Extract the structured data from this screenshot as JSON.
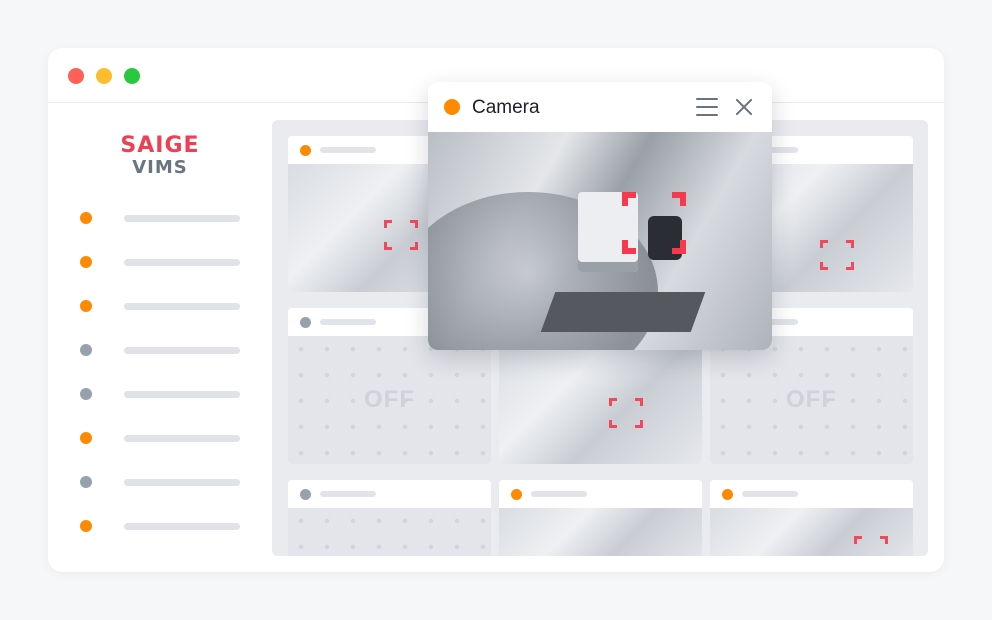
{
  "window": {
    "controls": [
      {
        "name": "close",
        "color": "#fe6057"
      },
      {
        "name": "minimize",
        "color": "#febc2e"
      },
      {
        "name": "zoom",
        "color": "#28c840"
      }
    ]
  },
  "logo": {
    "line1": "SAIGE",
    "line2": "VIMS",
    "brand_color": "#ee3f55",
    "secondary_color": "#6a7580"
  },
  "sidebar": {
    "items": [
      {
        "status": "active",
        "color": "#ff8a00"
      },
      {
        "status": "active",
        "color": "#ff8a00"
      },
      {
        "status": "active",
        "color": "#ff8a00"
      },
      {
        "status": "inactive",
        "color": "#97a1ad"
      },
      {
        "status": "inactive",
        "color": "#97a1ad"
      },
      {
        "status": "active",
        "color": "#ff8a00"
      },
      {
        "status": "inactive",
        "color": "#97a1ad"
      },
      {
        "status": "active",
        "color": "#ff8a00"
      }
    ]
  },
  "grid": {
    "cells": [
      {
        "status": "active",
        "color": "#ff8a00",
        "feed": "on"
      },
      {
        "status": "active",
        "color": "#ff8a00",
        "feed": "on"
      },
      {
        "status": "active",
        "color": "#ff8a00",
        "feed": "on"
      },
      {
        "status": "inactive",
        "color": "#97a1ad",
        "feed": "off",
        "label": "OFF"
      },
      {
        "status": "active",
        "color": "#ff8a00",
        "feed": "on"
      },
      {
        "status": "inactive",
        "color": "#97a1ad",
        "feed": "off",
        "label": "OFF"
      },
      {
        "status": "inactive",
        "color": "#97a1ad",
        "feed": "off"
      },
      {
        "status": "active",
        "color": "#ff8a00",
        "feed": "on"
      },
      {
        "status": "active",
        "color": "#ff8a00",
        "feed": "on"
      }
    ]
  },
  "popup": {
    "title": "Camera",
    "status_color": "#ff8a00",
    "menu_icon": "hamburger-menu-icon",
    "close_icon": "close-icon",
    "detection_color": "#f53a4f"
  }
}
